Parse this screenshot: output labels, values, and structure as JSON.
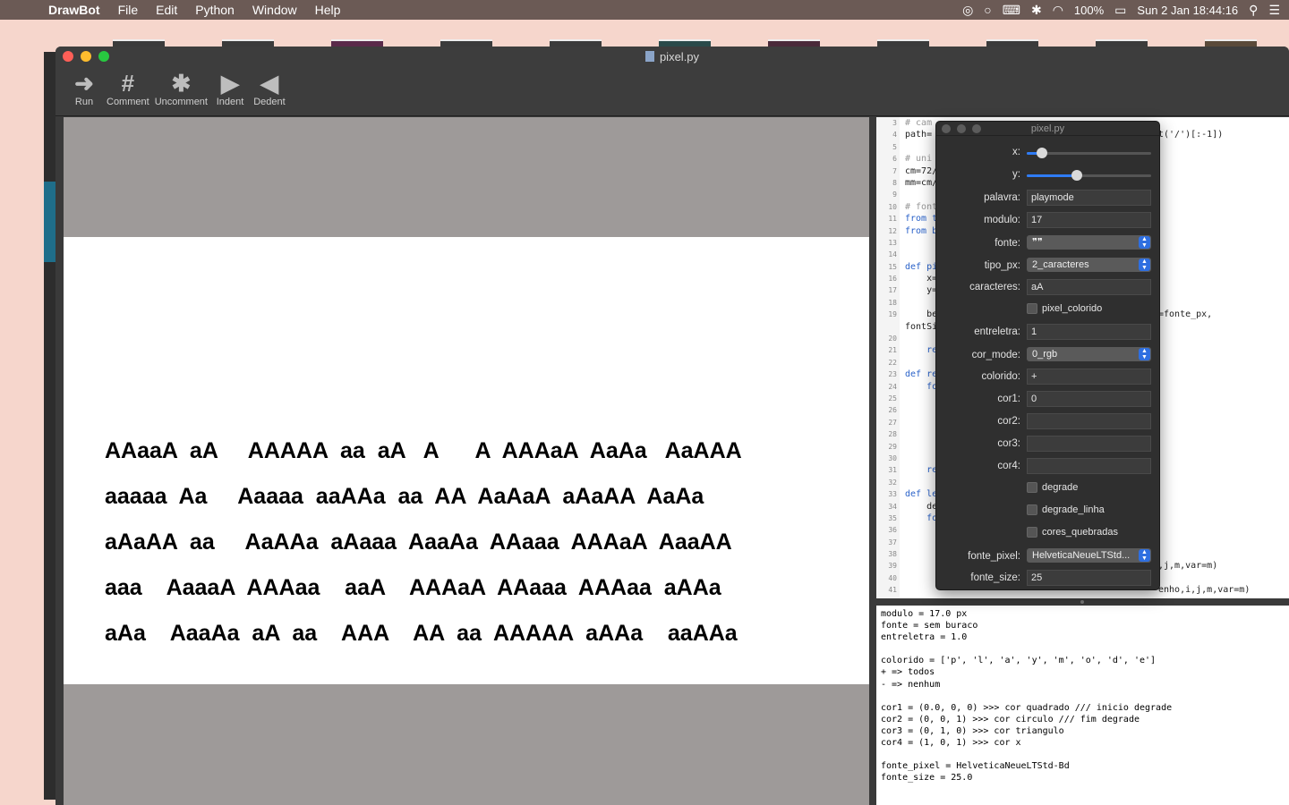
{
  "menubar": {
    "app_name": "DrawBot",
    "items": [
      "File",
      "Edit",
      "Python",
      "Window",
      "Help"
    ],
    "battery": "100%",
    "datetime": "Sun 2 Jan  18:44:16"
  },
  "window": {
    "title": "pixel.py",
    "toolbar": [
      {
        "label": "Run",
        "icon": "run-arrow-icon",
        "glyph": "➜"
      },
      {
        "label": "Comment",
        "icon": "comment-hash-icon",
        "glyph": "#"
      },
      {
        "label": "Uncomment",
        "icon": "uncomment-hash-icon",
        "glyph": "✱"
      },
      {
        "label": "Indent",
        "icon": "indent-triangle-icon",
        "glyph": "▶"
      },
      {
        "label": "Dedent",
        "icon": "dedent-triangle-icon",
        "glyph": "◀"
      }
    ]
  },
  "canvas": {
    "pixel_text_lines": [
      "AAaaA  aA     AAAAA  aa  aA   A      A  AAAaA  AaAa   AaAAA",
      "aaaaa  Aa     Aaaaa  aaAAa  aa  AA  AaAaA  aAaAA  AaAa",
      "aAaAA  aa     AaAAa  aAaaa  AaaAa  AAaaa  AAAaA  AaaAA",
      "aaa    AaaaA  AAAaa    aaA    AAAaA  AAaaa  AAAaa  aAAa",
      "aAa    AaaAa  aA  aa    AAA    AA  aa  AAAAA  aAAa    aaAAa"
    ]
  },
  "editor": {
    "line_numbers": [
      "3",
      "4",
      "5",
      "6",
      "7",
      "8",
      "9",
      "10",
      "11",
      "12",
      "13",
      "14",
      "15",
      "16",
      "17",
      "18",
      "19",
      "",
      "20",
      "21",
      "22",
      "23",
      "24",
      "25",
      "26",
      "27",
      "28",
      "29",
      "30",
      "31",
      "32",
      "33",
      "34",
      "35",
      "36",
      "37",
      "38",
      "39",
      "40",
      "41"
    ],
    "lines": [
      {
        "t": "# cam",
        "c": "cm",
        "right": ""
      },
      {
        "t": "path=",
        "c": "",
        "right": "t('/')[:-1])"
      },
      {
        "t": "",
        "c": "",
        "right": ""
      },
      {
        "t": "# uni",
        "c": "cm",
        "right": ""
      },
      {
        "t": "cm=72/",
        "c": "",
        "right": ""
      },
      {
        "t": "mm=cm/",
        "c": "",
        "right": ""
      },
      {
        "t": "",
        "c": "",
        "right": ""
      },
      {
        "t": "# font",
        "c": "cm",
        "right": ""
      },
      {
        "t": "from t",
        "c": "kw",
        "right": ""
      },
      {
        "t": "from b",
        "c": "kw",
        "right": ""
      },
      {
        "t": "",
        "c": "",
        "right": ""
      },
      {
        "t": "",
        "c": "",
        "right": ""
      },
      {
        "t": "def pi",
        "c": "kw",
        "right": ""
      },
      {
        "t": "    x=",
        "c": "",
        "right": ""
      },
      {
        "t": "    y=",
        "c": "",
        "right": ""
      },
      {
        "t": "",
        "c": "",
        "right": ""
      },
      {
        "t": "    be",
        "c": "",
        "right": "=fonte_px,"
      },
      {
        "t": "fontSi",
        "c": "",
        "right": ""
      },
      {
        "t": "",
        "c": "",
        "right": ""
      },
      {
        "t": "    re",
        "c": "kw",
        "right": ""
      },
      {
        "t": "",
        "c": "",
        "right": ""
      },
      {
        "t": "def re",
        "c": "kw",
        "right": ""
      },
      {
        "t": "    fo",
        "c": "kw",
        "right": ""
      },
      {
        "t": "",
        "c": "",
        "right": ""
      },
      {
        "t": "",
        "c": "",
        "right": ""
      },
      {
        "t": "",
        "c": "",
        "right": ""
      },
      {
        "t": "",
        "c": "",
        "right": ""
      },
      {
        "t": "",
        "c": "",
        "right": ""
      },
      {
        "t": "",
        "c": "",
        "right": ""
      },
      {
        "t": "    re",
        "c": "kw",
        "right": ""
      },
      {
        "t": "",
        "c": "",
        "right": ""
      },
      {
        "t": "def le",
        "c": "kw",
        "right": ""
      },
      {
        "t": "    de",
        "c": "",
        "right": ""
      },
      {
        "t": "    fo",
        "c": "kw",
        "right": ""
      },
      {
        "t": "",
        "c": "",
        "right": ""
      },
      {
        "t": "",
        "c": "",
        "right": ""
      },
      {
        "t": "",
        "c": "",
        "right": ""
      },
      {
        "t": "",
        "c": "",
        "right": ",j,m,var=m)"
      },
      {
        "t": "",
        "c": "",
        "right": ""
      },
      {
        "t": "",
        "c": "",
        "right": "enho,i,j,m,var=m)"
      }
    ]
  },
  "console": {
    "lines": [
      "modulo = 17.0 px",
      "fonte = sem buraco",
      "entreletra = 1.0",
      "",
      "colorido = ['p', 'l', 'a', 'y', 'm', 'o', 'd', 'e']",
      "+ => todos",
      "- => nenhum",
      "",
      "cor1 = (0.0, 0, 0) >>> cor quadrado /// inicio degrade",
      "cor2 = (0, 0, 1) >>> cor circulo /// fim degrade",
      "cor3 = (0, 1, 0) >>> cor triangulo",
      "cor4 = (1, 0, 1) >>> cor x",
      "",
      "fonte_pixel = HelveticaNeueLTStd-Bd",
      "fonte_size = 25.0"
    ]
  },
  "variables_panel": {
    "title": "pixel.py",
    "x_label": "x:",
    "x_value": 0.12,
    "y_label": "y:",
    "y_value": 0.4,
    "palavra_label": "palavra:",
    "palavra_value": "playmode",
    "modulo_label": "modulo:",
    "modulo_value": "17",
    "fonte_label": "fonte:",
    "fonte_value": "❞❞",
    "tipo_px_label": "tipo_px:",
    "tipo_px_value": "2_caracteres",
    "caracteres_label": "caracteres:",
    "caracteres_value": "aA",
    "pixel_colorido_label": "pixel_colorido",
    "entreletra_label": "entreletra:",
    "entreletra_value": "1",
    "cor_mode_label": "cor_mode:",
    "cor_mode_value": "0_rgb",
    "colorido_label": "colorido:",
    "colorido_value": "+",
    "cor1_label": "cor1:",
    "cor1_value": "0",
    "cor2_label": "cor2:",
    "cor2_value": "",
    "cor3_label": "cor3:",
    "cor3_value": "",
    "cor4_label": "cor4:",
    "cor4_value": "",
    "degrade_label": "degrade",
    "degrade_linha_label": "degrade_linha",
    "cores_quebradas_label": "cores_quebradas",
    "fonte_pixel_label": "fonte_pixel:",
    "fonte_pixel_value": "HelveticaNeueLTStd...",
    "fonte_size_label": "fonte_size:",
    "fonte_size_value": "25"
  },
  "colors": {
    "menubar_bg": "#6b5a55",
    "desktop_bg": "#f6d6cc",
    "accent": "#2f7cf6"
  }
}
